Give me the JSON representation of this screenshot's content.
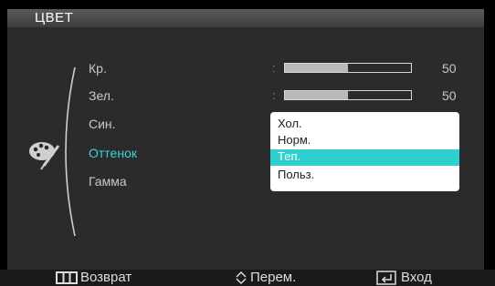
{
  "title": "ЦВЕТ",
  "menu": [
    {
      "label": "Кр.",
      "value": "50",
      "level": 0.5
    },
    {
      "label": "Зел.",
      "value": "50",
      "level": 0.5
    },
    {
      "label": "Син.",
      "value": "50",
      "level": 0.5
    },
    {
      "label": "Оттенок",
      "active": true
    },
    {
      "label": "Гамма"
    }
  ],
  "colon": ":",
  "dropdown": {
    "options": [
      "Хол.",
      "Норм.",
      "Теп.",
      "Польз."
    ],
    "selected": "Теп."
  },
  "footer": {
    "back": "Возврат",
    "move": "Перем.",
    "enter": "Вход"
  },
  "icons": [
    "palette-icon",
    "menu-icon",
    "up-down-arrows-icon",
    "enter-icon"
  ],
  "colors": {
    "accent": "#2ecfcf",
    "active_text": "#3bd4d4",
    "panel": "#2b2b2b"
  }
}
